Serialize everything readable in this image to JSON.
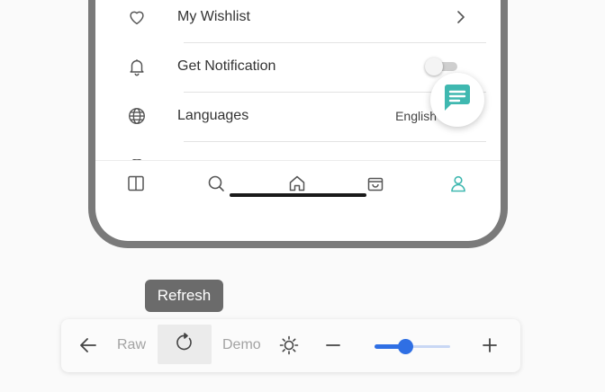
{
  "menu": {
    "items": [
      {
        "label": "My Wishlist",
        "icon": "heart-icon"
      },
      {
        "label": "Get Notification",
        "icon": "bell-icon",
        "toggle_on": false
      },
      {
        "label": "Languages",
        "icon": "globe-icon",
        "value": "English"
      }
    ]
  },
  "fab": {
    "icon": "chat-icon"
  },
  "bottom_nav": {
    "items": [
      {
        "icon": "book-icon"
      },
      {
        "icon": "search-icon"
      },
      {
        "icon": "home-icon"
      },
      {
        "icon": "shopping-bag-icon"
      },
      {
        "icon": "profile-icon",
        "active": true
      }
    ],
    "active_color": "#3fb8b0"
  },
  "tooltip": {
    "text": "Refresh"
  },
  "toolbar": {
    "raw_label": "Raw",
    "demo_label": "Demo",
    "zoom_level": 0.4,
    "accent": "#2f6fe4"
  }
}
